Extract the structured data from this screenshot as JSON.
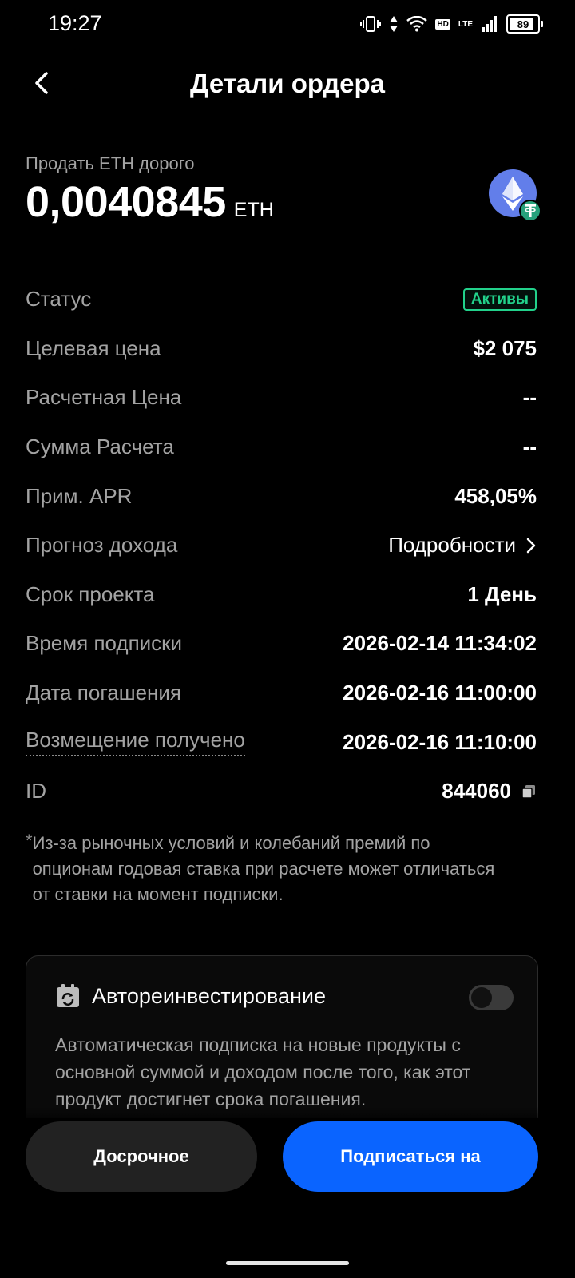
{
  "status_bar": {
    "time": "19:27",
    "hd": "HD",
    "lte": "LTE",
    "battery": "89"
  },
  "header": {
    "title": "Детали ордера"
  },
  "order": {
    "subtitle": "Продать ETH дорого",
    "amount": "0,0040845",
    "unit": "ETH",
    "coin_icon": "eth-usdt-pair-icon",
    "eth_color": "#627EEA",
    "usdt_color": "#26A17B"
  },
  "details": {
    "status": {
      "label": "Статус",
      "value": "Активы"
    },
    "target_price": {
      "label": "Целевая цена",
      "value": "$2 075"
    },
    "settlement_price": {
      "label": "Расчетная Цена",
      "value": "--"
    },
    "settlement_amount": {
      "label": "Сумма Расчета",
      "value": "--"
    },
    "apr": {
      "label": "Прим. APR",
      "value": "458,05%"
    },
    "income_forecast": {
      "label": "Прогноз дохода",
      "value": "Подробности"
    },
    "term": {
      "label": "Срок проекта",
      "value": "1 День"
    },
    "subscription_time": {
      "label": "Время подписки",
      "value": "2026-02-14 11:34:02"
    },
    "maturity_date": {
      "label": "Дата погашения",
      "value": "2026-02-16 11:00:00"
    },
    "refund_received": {
      "label": "Возмещение получено",
      "value": "2026-02-16 11:10:00"
    },
    "id": {
      "label": "ID",
      "value": "844060"
    }
  },
  "note": {
    "star": "*",
    "text": "Из-за рыночных условий и колебаний премий по опционам годовая ставка при расчете может отличаться от ставки на момент подписки."
  },
  "auto_reinvest": {
    "title": "Автореинвестирование",
    "enabled": false,
    "description": "Автоматическая подписка на новые продукты с основной суммой и доходом после того, как этот продукт достигнет срока погашения."
  },
  "actions": {
    "early_label": "Досрочное",
    "subscribe_label": "Подписаться на"
  },
  "colors": {
    "accent_blue": "#0A64FF",
    "status_green": "#22D18B"
  }
}
